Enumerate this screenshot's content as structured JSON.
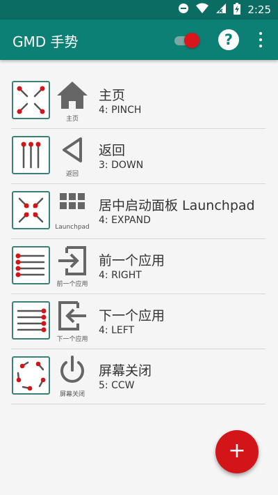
{
  "status_bar": {
    "time": "2:25"
  },
  "app_bar": {
    "title": "GMD 手势",
    "help_label": "?"
  },
  "colors": {
    "primary": "#0d8076",
    "accent": "#d31418"
  },
  "gestures": [
    {
      "title": "主页",
      "subtitle": "4: PINCH",
      "caption": "主页",
      "gesture_icon": "pinch-icon",
      "action_icon": "home-icon"
    },
    {
      "title": "返回",
      "subtitle": "3: DOWN",
      "caption": "返回",
      "gesture_icon": "three-finger-down-icon",
      "action_icon": "back-triangle-icon"
    },
    {
      "title": "居中启动面板 Launchpad",
      "subtitle": "4: EXPAND",
      "caption": "Launchpad",
      "gesture_icon": "expand-icon",
      "action_icon": "grid-icon"
    },
    {
      "title": "前一个应用",
      "subtitle": "4: RIGHT",
      "caption": "前一个应用",
      "gesture_icon": "swipe-right-icon",
      "action_icon": "enter-right-icon"
    },
    {
      "title": "下一个应用",
      "subtitle": "4: LEFT",
      "caption": "下一个应用",
      "gesture_icon": "swipe-left-icon",
      "action_icon": "enter-left-icon"
    },
    {
      "title": "屏幕关闭",
      "subtitle": "5: CCW",
      "caption": "屏幕关闭",
      "gesture_icon": "rotate-ccw-icon",
      "action_icon": "power-icon"
    }
  ],
  "fab": {
    "label": "+"
  }
}
